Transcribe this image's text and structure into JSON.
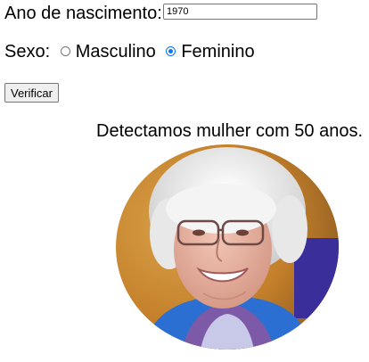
{
  "form": {
    "birth_label": "Ano de nascimento:",
    "birth_value": "1970",
    "sex_label": "Sexo:",
    "options": [
      {
        "label": "Masculino",
        "checked": false
      },
      {
        "label": "Feminino",
        "checked": true
      }
    ],
    "submit_label": "Verificar"
  },
  "result": {
    "text": "Detectamos mulher com 50 anos."
  },
  "photo": {
    "icon": "elderly-woman-photo"
  }
}
